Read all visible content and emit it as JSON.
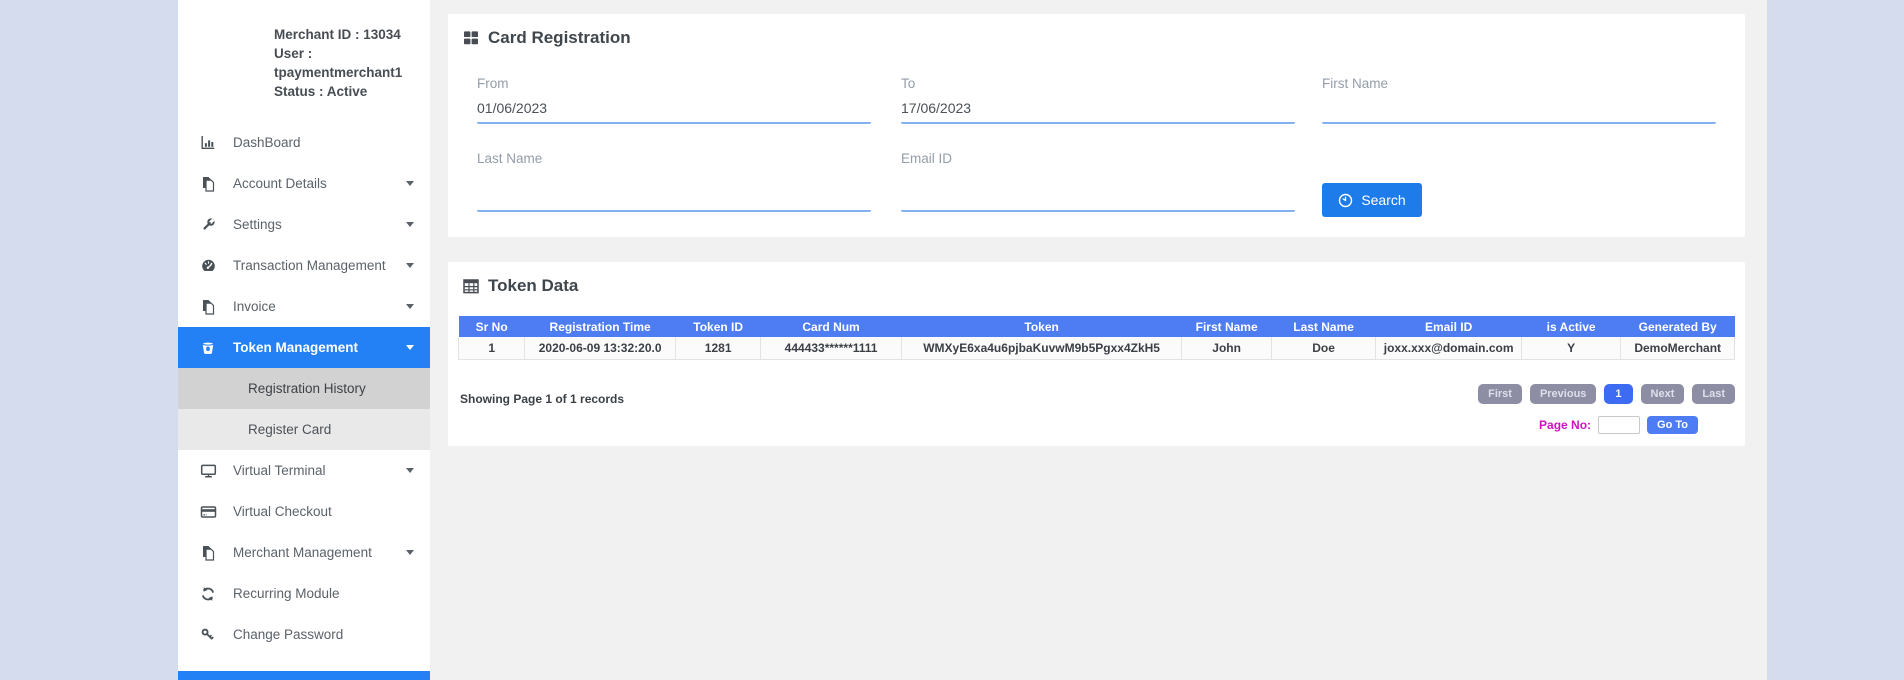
{
  "colors": {
    "page_background": "#d4dcee",
    "sidebar_background": "#ffffff",
    "main_background": "#f1f1f2",
    "active_menu_blue": "#2480f5",
    "table_header_blue": "#4d7cf3",
    "search_button_blue": "#1d7ce9",
    "pagination_gray": "#8d8da3",
    "current_page_blue": "#3d6cf2",
    "goto_button_blue": "#4d7cf5",
    "page_no_magenta": "#cf10c4",
    "field_underline_blue": "#85b0f0"
  },
  "sidebar": {
    "merchant_info": {
      "line1": "Merchant ID : 13034",
      "line2": "User :",
      "line3": "tpaymentmerchant1",
      "line4": "Status : Active"
    },
    "items": [
      {
        "label": "DashBoard",
        "icon": "bar-chart-icon",
        "caret": false
      },
      {
        "label": "Account Details",
        "icon": "pages-icon",
        "caret": true
      },
      {
        "label": "Settings",
        "icon": "wrench-icon",
        "caret": true
      },
      {
        "label": "Transaction Management",
        "icon": "gauge-icon",
        "caret": true
      },
      {
        "label": "Invoice",
        "icon": "pages-icon",
        "caret": true
      },
      {
        "label": "Token Management",
        "icon": "bucket-icon",
        "caret": true,
        "active": true
      },
      {
        "label": "Registration History",
        "sub": true,
        "selected": true
      },
      {
        "label": "Register Card",
        "sub": true,
        "selected": false
      },
      {
        "label": "Virtual Terminal",
        "icon": "monitor-icon",
        "caret": true
      },
      {
        "label": "Virtual Checkout",
        "icon": "credit-card-icon",
        "caret": false
      },
      {
        "label": "Merchant Management",
        "icon": "pages-icon",
        "caret": true
      },
      {
        "label": "Recurring Module",
        "icon": "refresh-icon",
        "caret": false
      },
      {
        "label": "Change Password",
        "icon": "key-icon",
        "caret": false
      }
    ]
  },
  "card_registration": {
    "title": "Card Registration",
    "fields": {
      "from": {
        "label": "From",
        "value": "01/06/2023"
      },
      "to": {
        "label": "To",
        "value": "17/06/2023"
      },
      "first_name": {
        "label": "First Name",
        "value": ""
      },
      "last_name": {
        "label": "Last Name",
        "value": ""
      },
      "email_id": {
        "label": "Email ID",
        "value": ""
      }
    },
    "search_label": "Search"
  },
  "token_data": {
    "title": "Token Data",
    "columns": [
      "Sr No",
      "Registration Time",
      "Token ID",
      "Card Num",
      "Token",
      "First Name",
      "Last Name",
      "Email ID",
      "is Active",
      "Generated By"
    ],
    "rows": [
      [
        "1",
        "2020-06-09 13:32:20.0",
        "1281",
        "444433******1111",
        "WMXyE6xa4u6pjbaKuvwM9b5Pgxx4ZkH5",
        "John",
        "Doe",
        "joxx.xxx@domain.com",
        "Y",
        "DemoMerchant"
      ]
    ],
    "summary": "Showing Page 1 of 1 records",
    "pagination": {
      "first": "First",
      "previous": "Previous",
      "current_page": "1",
      "next": "Next",
      "last": "Last",
      "page_no_label": "Page No:",
      "page_input_value": "",
      "goto_label": "Go To"
    }
  }
}
